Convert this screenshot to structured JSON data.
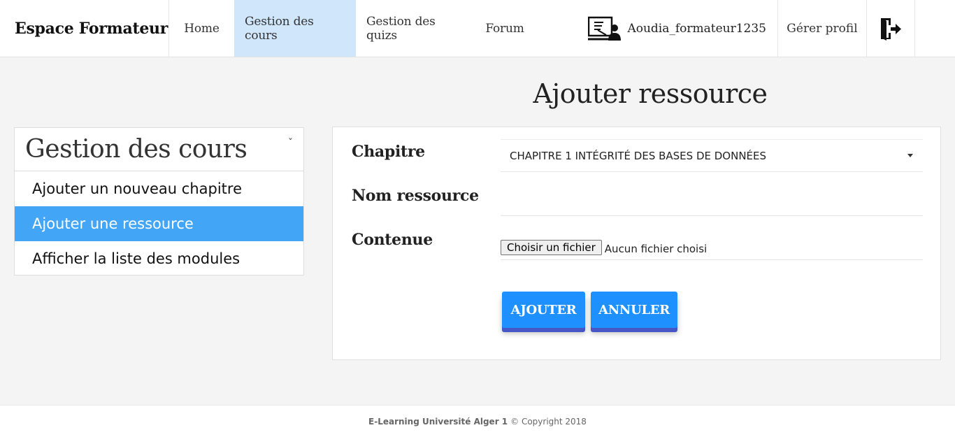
{
  "navbar": {
    "brand": "Espace Formateur",
    "items": [
      {
        "label": "Home",
        "active": false
      },
      {
        "label": "Gestion des cours",
        "active": true
      },
      {
        "label": "Gestion des quizs",
        "active": false
      },
      {
        "label": "Forum",
        "active": false
      }
    ],
    "username": "Aoudia_formateur1235",
    "profile_label": "Gérer profil",
    "icons": {
      "user": "teacher-board-icon",
      "logout": "logout-door-icon"
    }
  },
  "page_title": "Ajouter ressource",
  "sidebar": {
    "title": "Gestion des cours",
    "chevron": "chevron-down-icon",
    "items": [
      {
        "label": "Ajouter un nouveau chapitre",
        "active": false
      },
      {
        "label": "Ajouter une ressource",
        "active": true
      },
      {
        "label": "Afficher la liste des modules",
        "active": false
      }
    ]
  },
  "form": {
    "chapitre_label": "Chapitre",
    "chapitre_value": "CHAPITRE 1 INTÉGRITÉ DES BASES DE DONNÉES",
    "nom_label": "Nom ressource",
    "nom_value": "",
    "contenue_label": "Contenue",
    "file_button": "Choisir un fichier",
    "file_status": "Aucun fichier choisi",
    "submit_label": "AJOUTER",
    "cancel_label": "ANNULER"
  },
  "colors": {
    "accent": "#42a5f5",
    "nav_active": "#cfe6fb",
    "button": "#1e90ff",
    "button_shadow": "#4656c6"
  },
  "footer": {
    "org": "E-Learning Université Alger 1",
    "copyright": "© Copyright 2018"
  }
}
